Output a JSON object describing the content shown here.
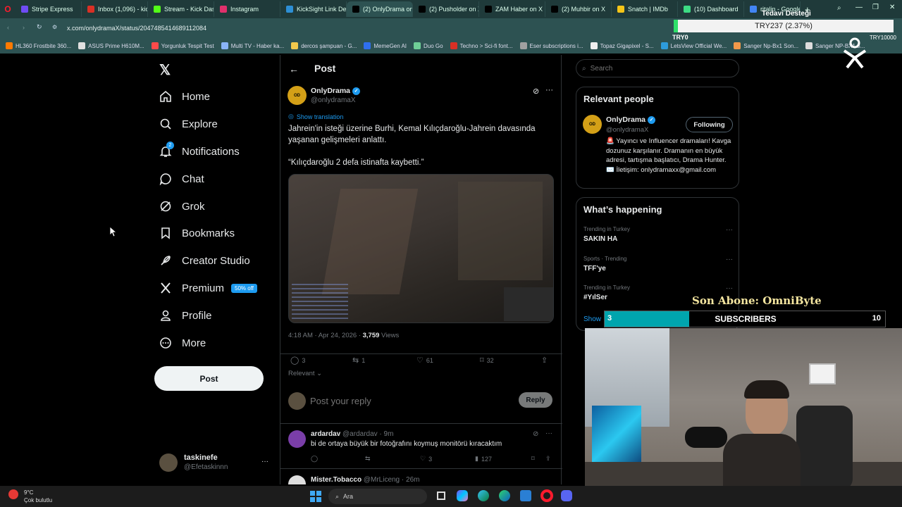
{
  "browser": {
    "tabs": [
      {
        "label": "Stripe Express",
        "color": "#6f4cf5"
      },
      {
        "label": "Inbox (1,096) - kick",
        "color": "#d93025"
      },
      {
        "label": "Stream - Kick Dashb",
        "color": "#53fc18"
      },
      {
        "label": "Instagram",
        "color": "#e1306c"
      },
      {
        "label": "KickSight Link Dete",
        "color": "#2d8fd5"
      },
      {
        "label": "(2) OnlyDrama on X:",
        "color": "#000000"
      },
      {
        "label": "(2) Pusholder on X:",
        "color": "#000000"
      },
      {
        "label": "ZAM Haber on X",
        "color": "#000000"
      },
      {
        "label": "(2) Muhbir on X",
        "color": "#000000"
      },
      {
        "label": "Snatch | IMDb",
        "color": "#f5c518"
      },
      {
        "label": "(10) Dashboard",
        "color": "#3ddc84"
      },
      {
        "label": "ritalin - Google'da",
        "color": "#4285f4"
      }
    ],
    "url": "x.com/onlydramaX/status/2047485414689112084",
    "bookmarks": [
      "HL360 Frostbite 360...",
      "ASUS Prime H610M...",
      "Yorgunluk Tespit Test",
      "Multi TV - Haber ka...",
      "dercos şampuan - G...",
      "MemeGen AI",
      "Duo Go",
      "Techno > Sci-fi font...",
      "Eser subscriptions i...",
      "Topaz Gigapixel - S...",
      "LetsView Official We...",
      "Sanger Np-Bx1 Son...",
      "Sanger NP-BX1 5..."
    ]
  },
  "overlay": {
    "donation_title": "Tedavi Desteği",
    "donation_amount": "TRY237 (2.37%)",
    "donation_min": "TRY0",
    "donation_max": "TRY10000",
    "last_sub": "Son Abone: OmniByte",
    "sub_count": "3",
    "sub_label": "SUBSCRIBERS",
    "sub_goal": "10",
    "sub_progress": 0.3
  },
  "nav": {
    "items": [
      {
        "label": "Home",
        "icon": "home-icon"
      },
      {
        "label": "Explore",
        "icon": "search-icon"
      },
      {
        "label": "Notifications",
        "icon": "bell-icon",
        "badge": "2"
      },
      {
        "label": "Chat",
        "icon": "chat-icon"
      },
      {
        "label": "Grok",
        "icon": "grok-icon"
      },
      {
        "label": "Bookmarks",
        "icon": "bookmark-icon"
      },
      {
        "label": "Creator Studio",
        "icon": "rocket-icon"
      },
      {
        "label": "Premium",
        "icon": "x-icon",
        "badge": "50% off"
      },
      {
        "label": "Profile",
        "icon": "person-icon"
      },
      {
        "label": "More",
        "icon": "more-icon"
      }
    ],
    "post_button": "Post",
    "account_name": "taskinefe",
    "account_handle": "@Efetaskinnn"
  },
  "post": {
    "header": "Post",
    "author": "OnlyDrama",
    "handle": "@onlydramaX",
    "show_translation": "Show translation",
    "text1": "Jahrein'in isteği üzerine Burhi, Kemal Kılıçdaroğlu-Jahrein davasında yaşanan gelişmeleri anlattı.",
    "text2": "“Kılıçdaroğlu 2 defa istinafta kaybetti.”",
    "time": "4:18 AM · Apr 24, 2026 · ",
    "views_count": "3,759",
    "views_label": " Views",
    "replies": "3",
    "reposts": "1",
    "likes": "61",
    "bookmarks": "32",
    "sort": "Relevant",
    "reply_placeholder": "Post your reply",
    "reply_button": "Reply"
  },
  "replies": [
    {
      "name": "ardardav",
      "handle": "@ardardav · 9m",
      "text": "bi de ortaya büyük bir fotoğrafını koymuş monitörü kıracaktım",
      "replies": "",
      "reposts": "",
      "likes": "3",
      "views": "127"
    },
    {
      "name": "Mister.Tobacco",
      "handle": "@MrLiceng · 26m"
    }
  ],
  "right": {
    "search_placeholder": "Search",
    "relevant_title": "Relevant people",
    "person_name": "OnlyDrama",
    "person_handle": "@onlydramaX",
    "follow_button": "Following",
    "bio": "🚨 Yayıncı ve Influencer dramaları! Kavga dozunuz karşılanır. Dramanın en büyük adresi, tartışma başlatıcı, Drama Hunter. ✉️ İletişim: onlydramaxx@gmail.com",
    "happening_title": "What’s happening",
    "trends": [
      {
        "meta": "Trending in Turkey",
        "name": "SAKIN HA"
      },
      {
        "meta": "Sports · Trending",
        "name": "TFF'ye"
      },
      {
        "meta": "Trending in Turkey",
        "name": "#YılSer"
      }
    ],
    "show_more": "Show"
  },
  "taskbar": {
    "weather_temp": "9°C",
    "weather_desc": "Çok bulutlu",
    "search_label": "Ara"
  },
  "colors": {
    "accent": "#1d9bf0",
    "browser_bg": "#2d5252",
    "sub_bar": "#00a5ae"
  }
}
